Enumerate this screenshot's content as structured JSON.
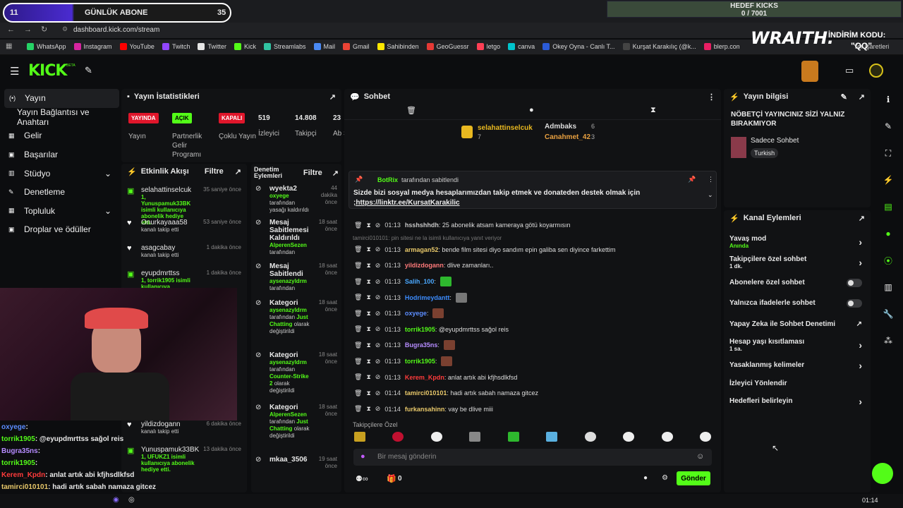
{
  "overlay_top": {
    "badge_num": "11",
    "sub_label": "GÜNLÜK ABONE",
    "sub_count": "35",
    "goal_title": "HEDEF KICKS",
    "goal_value": "0 / 7001",
    "wraith": "WRAITH.",
    "discount": "İNDİRİM KODU:",
    "code": "\"QQ\""
  },
  "browser": {
    "url": "dashboard.kick.com/stream",
    "bookmarks_right": "Yer İşaretleri",
    "bookmarks": [
      {
        "label": "WhatsApp",
        "color": "#25d366"
      },
      {
        "label": "Instagram",
        "color": "#d6249f"
      },
      {
        "label": "YouTube",
        "color": "#ff0000"
      },
      {
        "label": "Twitch",
        "color": "#9146ff"
      },
      {
        "label": "Twitter",
        "color": "#e6e6e6"
      },
      {
        "label": "Kick",
        "color": "#53fc18"
      },
      {
        "label": "Streamlabs",
        "color": "#31c3a2"
      },
      {
        "label": "Mail",
        "color": "#4a8af4"
      },
      {
        "label": "Gmail",
        "color": "#ea4335"
      },
      {
        "label": "Sahibinden",
        "color": "#ffe800"
      },
      {
        "label": "GeoGuessr",
        "color": "#e53935"
      },
      {
        "label": "letgo",
        "color": "#ff3f55"
      },
      {
        "label": "canva",
        "color": "#00c4cc"
      },
      {
        "label": "Okey Oyna - Canlı T...",
        "color": "#2b5bd7"
      },
      {
        "label": "Kurşat Karakılıç (@k...",
        "color": "#444"
      },
      {
        "label": "blerp.com/dashboar...",
        "color": "#e91e63"
      },
      {
        "label": "kurs",
        "color": "#888"
      }
    ]
  },
  "app": {
    "logo": "KICK",
    "beta": "BETA"
  },
  "sidebar": {
    "items": [
      {
        "label": "Yayın",
        "active": true
      },
      {
        "label": "Yayın Bağlantısı ve Anahtarı"
      },
      {
        "label": "Gelir"
      },
      {
        "label": "Başarılar"
      },
      {
        "label": "Stüdyo"
      },
      {
        "label": "Denetleme"
      },
      {
        "label": "Topluluk"
      },
      {
        "label": "Droplar ve ödüller"
      }
    ]
  },
  "stats": {
    "title": "Yayın İstatistikleri",
    "items": [
      {
        "tag": "YAYINDA",
        "tag_color": "#e0162b",
        "label": "Yayın"
      },
      {
        "tag": "AÇIK",
        "tag_color": "#53fc18",
        "label": "Partnerlik Gelir Programı"
      },
      {
        "tag": "KAPALI",
        "tag_color": "#e0162b",
        "label": "Çoklu Yayın"
      },
      {
        "value": "519",
        "label": "İzleyici"
      },
      {
        "value": "14.808",
        "label": "Takipçi"
      },
      {
        "value": "23",
        "label": "Ab Sa"
      }
    ]
  },
  "activity": {
    "title": "Etkinlik Akışı",
    "filter": "Filtre",
    "events": [
      {
        "name": "selahattinselcuk",
        "sub": "1, Yunuspamuk33BK isimli kullanıcıya abonelik hediye etti.",
        "time": "35 saniye önce",
        "icon": "gift"
      },
      {
        "name": "Onurkayaaa58",
        "sub": "kanalı takip etti",
        "time": "53 saniye önce",
        "icon": "heart"
      },
      {
        "name": "asagcabay",
        "sub": "kanalı takip etti",
        "time": "1 dakika önce",
        "icon": "heart"
      },
      {
        "name": "eyupdmrttss",
        "sub": "1, torrik1905 isimli kullanıcıya",
        "time": "1 dakika önce",
        "icon": "gift"
      }
    ],
    "bottom": [
      {
        "name": "yildizdogann",
        "sub": "kanalı takip etti",
        "time": "6 dakika önce",
        "icon": "heart"
      },
      {
        "name": "Yunuspamuk33BK",
        "sub": "1, UFUKZ1 isimli kullanıcıya abonelik hediye etti.",
        "time": "13 dakika önce",
        "icon": "gift"
      }
    ]
  },
  "moderation": {
    "title": "Denetim Eylemleri",
    "filter": "Filtre",
    "items": [
      {
        "title": "wyekta2",
        "sub1": "oxyege",
        "sub2": "tarafından yasağı kaldırıldı",
        "time": "44 dakika önce"
      },
      {
        "title": "Mesaj Sabitlemesi Kaldırıldı",
        "sub1": "AlperenSezen",
        "sub2": "tarafından",
        "time": "18 saat önce"
      },
      {
        "title": "Mesaj Sabitlendi",
        "sub1": "aysenazyldrm",
        "sub2": "tarafından",
        "time": "18 saat önce"
      },
      {
        "title": "Kategori",
        "sub1": "aysenazyldrm",
        "sub2": "tarafından",
        "sub3": "Just Chatting",
        "sub4": "olarak değiştirildi",
        "time": "18 saat önce"
      },
      {
        "title": "Kategori",
        "sub1": "aysenazyldrm",
        "sub2": "tarafından",
        "sub3": "Counter-Strike 2",
        "sub4": "olarak değiştirildi",
        "time": "18 saat önce"
      },
      {
        "title": "Kategori",
        "sub1": "AlperenSezen",
        "sub2": "tarafından",
        "sub3": "Just Chatting",
        "sub4": "olarak değiştirildi",
        "time": "18 saat önce"
      },
      {
        "title": "mkaa_3506",
        "time": "19 saat önce"
      }
    ]
  },
  "chat": {
    "title": "Sohbet",
    "top1": "selahattinselcuk",
    "top1_count": "7",
    "top2": "Admbaks",
    "top2_count": "6",
    "top3": "Canahmet_42",
    "top3_count": "3",
    "pinned_by": "BotRix",
    "pinned_suffix": "tarafından sabitlendi",
    "pinned_text": "Sizde bizi sosyal medya hesaplarımızdan takip etmek ve donateden destek olmak için",
    "pinned_link": ";https://linktr.ee/KursatKarakilic",
    "reply_hint": "tamirci010101: pin sitesi ne la isimli kullanıcıya yanıt veriyor",
    "messages": [
      {
        "time": "01:13",
        "user": "hsshshhdh",
        "color": "#c8c8c8",
        "text": ": 25 abonelik atsam kameraya götü koyarmısın"
      },
      {
        "time": "01:13",
        "user": "armagan52",
        "color": "#e8c86a",
        "text": ": bende film sitesi diyo sandım epin galiba sen diyince farkettim"
      },
      {
        "time": "01:13",
        "user": "yildizdogann",
        "color": "#ff7a7a",
        "text": ": dlive zamanları.."
      },
      {
        "time": "01:13",
        "user": "Salih_100",
        "color": "#4aa8ff",
        "text": ":",
        "emote": "#2eb82e"
      },
      {
        "time": "01:13",
        "user": "Hodrimeydantt",
        "color": "#3c8cff",
        "text": ":",
        "emote": "#777"
      },
      {
        "time": "01:13",
        "user": "oxyege",
        "color": "#5c8dff",
        "text": ":",
        "emote": "#7a4030"
      },
      {
        "time": "01:13",
        "user": "torrik1905",
        "color": "#53fc18",
        "text": ": @eyupdmrttss sağol reis"
      },
      {
        "time": "01:13",
        "user": "Bugra35ns",
        "color": "#b68cff",
        "text": ":",
        "emote": "#7a4030"
      },
      {
        "time": "01:13",
        "user": "torrik1905",
        "color": "#53fc18",
        "text": ":",
        "emote": "#7a4030"
      },
      {
        "time": "01:13",
        "user": "Kerem_Kpdn",
        "color": "#ff3b3b",
        "text": ": anlat artık abi kfjhsdlkfsd"
      },
      {
        "time": "01:14",
        "user": "tamirci010101",
        "color": "#e8c86a",
        "text": ": hadi artık sabah namaza gitcez"
      },
      {
        "time": "01:14",
        "user": "furkansahinn",
        "color": "#e8c86a",
        "text": ": vay be dlive miii"
      }
    ],
    "followers_only": "Takipçilere Özel",
    "input_placeholder": "Bir mesaj gönderin",
    "send": "Gönder",
    "bits": "0"
  },
  "info": {
    "title": "Yayın bilgisi",
    "stream_title": "NÖBETÇİ YAYINCINIZ SİZİ YALNIZ BIRAKMIYOR",
    "category": "Sadece Sohbet",
    "language": "Turkish"
  },
  "channel_actions": {
    "title": "Kanal Eylemleri",
    "rows": [
      {
        "label": "Yavaş mod",
        "sub": "Anında",
        "ctrl": "chevron"
      },
      {
        "label": "Takipçilere özel sohbet",
        "sub": "1 dk.",
        "ctrl": "chevron"
      },
      {
        "label": "Abonelere özel sohbet",
        "ctrl": "toggle"
      },
      {
        "label": "Yalnızca ifadelerle sohbet",
        "ctrl": "toggle"
      },
      {
        "label": "Yapay Zeka ile Sohbet Denetimi",
        "ctrl": "ext"
      },
      {
        "label": "Hesap yaşı kısıtlaması",
        "sub": "1 sa.",
        "ctrl": "chevron"
      },
      {
        "label": "Yasaklanmış kelimeler",
        "ctrl": "chevron"
      },
      {
        "label": "İzleyici Yönlendir",
        "ctrl": "none"
      },
      {
        "label": "Hedefleri belirleyin",
        "ctrl": "chevron"
      }
    ]
  },
  "overlay_chat": [
    {
      "user": "oxyege",
      "color": "#5c8dff",
      "text": ":"
    },
    {
      "user": "torrik1905",
      "color": "#53fc18",
      "text": ": @eyupdmrttss sağol reis"
    },
    {
      "user": "Bugra35ns",
      "color": "#b68cff",
      "text": ":"
    },
    {
      "user": "torrik1905",
      "color": "#53fc18",
      "text": ":"
    },
    {
      "user": "Kerem_Kpdn",
      "color": "#ff3b3b",
      "text": ": anlat artık abi kfjhsdlkfsd"
    },
    {
      "user": "tamirci010101",
      "color": "#e8c86a",
      "text": ": hadi artık sabah namaza gitcez"
    },
    {
      "user": "furkansahinn",
      "color": "#e8c86a",
      "text": ": vay be dlive miii"
    }
  ],
  "taskbar": {
    "clock": "01:14"
  }
}
